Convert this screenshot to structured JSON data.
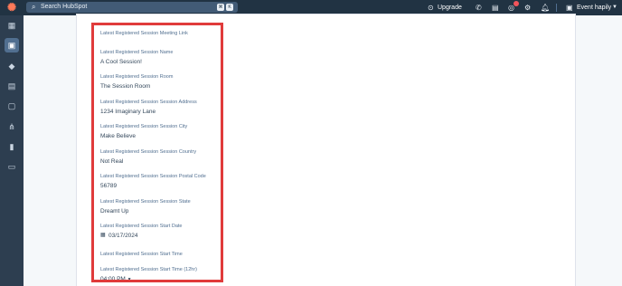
{
  "topbar": {
    "search_placeholder": "Search HubSpot",
    "shortcut_keys": [
      "⌘",
      "K"
    ],
    "upgrade_label": "Upgrade",
    "account_name": "Event hapily",
    "icons": [
      "hubspot-logo-icon",
      "search-icon",
      "upgrade-icon",
      "phone-icon",
      "marketplace-icon",
      "help-icon",
      "settings-icon",
      "notifications-icon",
      "account-icon",
      "chevron-down-icon"
    ]
  },
  "sidebar": {
    "items": [
      {
        "icon": "grid-icon",
        "glyph": "▦"
      },
      {
        "icon": "contacts-icon",
        "glyph": "▣",
        "active": true
      },
      {
        "icon": "marketing-icon",
        "glyph": "◆"
      },
      {
        "icon": "calendar-icon",
        "glyph": "▤"
      },
      {
        "icon": "service-icon",
        "glyph": "▢"
      },
      {
        "icon": "automation-icon",
        "glyph": "⋔"
      },
      {
        "icon": "reports-icon",
        "glyph": "▮"
      },
      {
        "icon": "folder-icon",
        "glyph": "▭"
      }
    ]
  },
  "fields": [
    {
      "label": "Latest Registered Session Meeting Link",
      "value": ""
    },
    {
      "label": "Latest Registered Session Name",
      "value": "A Cool Session!"
    },
    {
      "label": "Latest Registered Session Room",
      "value": "The Session Room"
    },
    {
      "label": "Latest Registered Session Session Address",
      "value": "1234 Imaginary Lane"
    },
    {
      "label": "Latest Registered Session Session City",
      "value": "Make Believe"
    },
    {
      "label": "Latest Registered Session Session Country",
      "value": "Not Real"
    },
    {
      "label": "Latest Registered Session Session Postal Code",
      "value": "56789"
    },
    {
      "label": "Latest Registered Session Session State",
      "value": "Dreamt Up"
    },
    {
      "label": "Latest Registered Session Start Date",
      "value": "03/17/2024"
    },
    {
      "label": "Latest Registered Session Start Time",
      "value": ""
    },
    {
      "label": "Latest Registered Session Start Time (12hr)",
      "value": "04:00 PM"
    }
  ],
  "colors": {
    "topbar": "#213343",
    "sidebar": "#2d3e50",
    "highlight": "#e03b3b",
    "brand": "#ff7a59"
  }
}
